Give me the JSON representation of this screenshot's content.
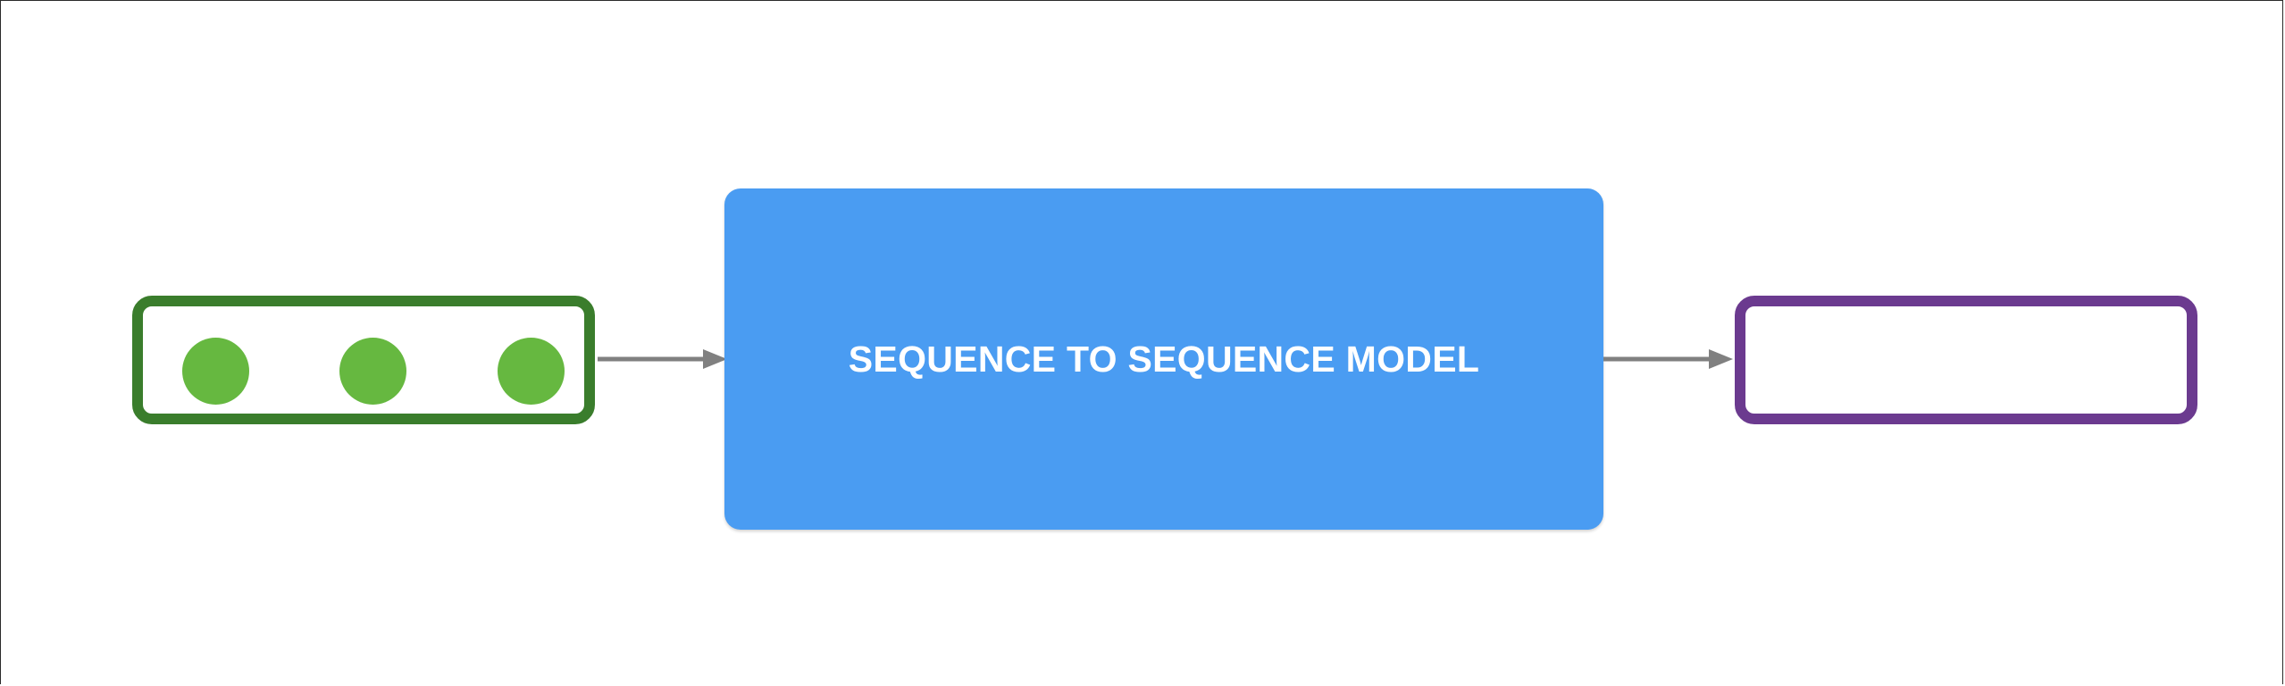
{
  "diagram": {
    "model_label": "SEQUENCE TO SEQUENCE MODEL",
    "input_tokens": [
      "token",
      "token",
      "token"
    ],
    "colors": {
      "input_border": "#3a7d2c",
      "token_fill": "#66b840",
      "model_fill": "#4a9cf2",
      "model_text": "#ffffff",
      "output_border": "#6b3a8f",
      "arrow": "#808080"
    },
    "icons": {
      "input_to_model": "arrow-right-icon",
      "model_to_output": "arrow-right-icon"
    }
  }
}
